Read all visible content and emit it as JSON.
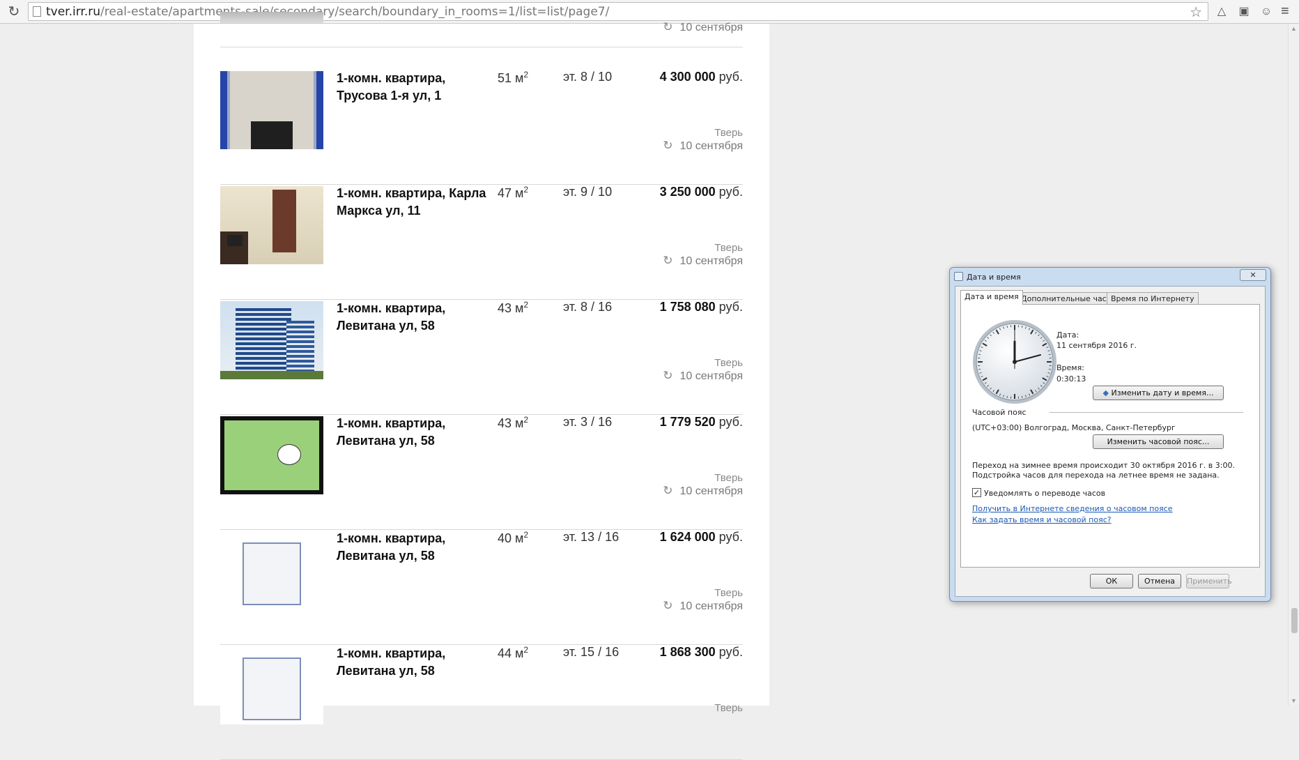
{
  "browser": {
    "url_host": "tver.irr.ru",
    "url_path": "/real-estate/apartments-sale/secondary/search/boundary_in_rooms=1/list=list/page7/"
  },
  "top_partial": {
    "date": "10 сентября"
  },
  "listings": [
    {
      "title": "1-комн. квартира, Трусова 1-я ул, 1",
      "area": "51 м",
      "floor": "эт. 8 / 10",
      "price": "4 300 000",
      "currency": "руб.",
      "city": "Тверь",
      "date": "10 сентября",
      "thumb": "room-tiles"
    },
    {
      "title": "1-комн. квартира, Карла Маркса ул, 11",
      "area": "47 м",
      "floor": "эт. 9 / 10",
      "price": "3 250 000",
      "currency": "руб.",
      "city": "Тверь",
      "date": "10 сентября",
      "thumb": "room"
    },
    {
      "title": "1-комн. квартира, Левитана ул, 58",
      "area": "43 м",
      "floor": "эт. 8 / 16",
      "price": "1 758 080",
      "currency": "руб.",
      "city": "Тверь",
      "date": "10 сентября",
      "thumb": "building"
    },
    {
      "title": "1-комн. квартира, Левитана ул, 58",
      "area": "43 м",
      "floor": "эт. 3 / 16",
      "price": "1 779 520",
      "currency": "руб.",
      "city": "Тверь",
      "date": "10 сентября",
      "thumb": "floorplan-green"
    },
    {
      "title": "1-комн. квартира, Левитана ул, 58",
      "area": "40 м",
      "floor": "эт. 13 / 16",
      "price": "1 624 000",
      "currency": "руб.",
      "city": "Тверь",
      "date": "10 сентября",
      "thumb": "floorplan-sketch"
    },
    {
      "title": "1-комн. квартира, Левитана ул, 58",
      "area": "44 м",
      "floor": "эт. 15 / 16",
      "price": "1 868 300",
      "currency": "руб.",
      "city": "Тверь",
      "date": "",
      "thumb": "floorplan-sketch"
    }
  ],
  "area_unit_sup": "2",
  "dialog": {
    "title": "Дата и время",
    "tabs": [
      "Дата и время",
      "Дополнительные часы",
      "Время по Интернету"
    ],
    "date_label": "Дата:",
    "date_value": "11 сентября 2016 г.",
    "time_label": "Время:",
    "time_value": "0:30:13",
    "change_datetime_button": "Изменить дату и время...",
    "timezone_label": "Часовой пояс",
    "timezone_value": "(UTC+03:00) Волгоград, Москва, Санкт-Петербург",
    "change_timezone_button": "Изменить часовой пояс...",
    "dst_line1": "Переход на зимнее время происходит 30 октября 2016 г. в 3:00.",
    "dst_line2": "Подстройка часов для перехода на летнее время не задана.",
    "notify_label": "Уведомлять о переводе часов",
    "notify_checked": true,
    "link1": "Получить в Интернете сведения о часовом поясе",
    "link2": "Как задать время и часовой пояс?",
    "ok": "ОК",
    "cancel": "Отмена",
    "apply": "Применить"
  }
}
